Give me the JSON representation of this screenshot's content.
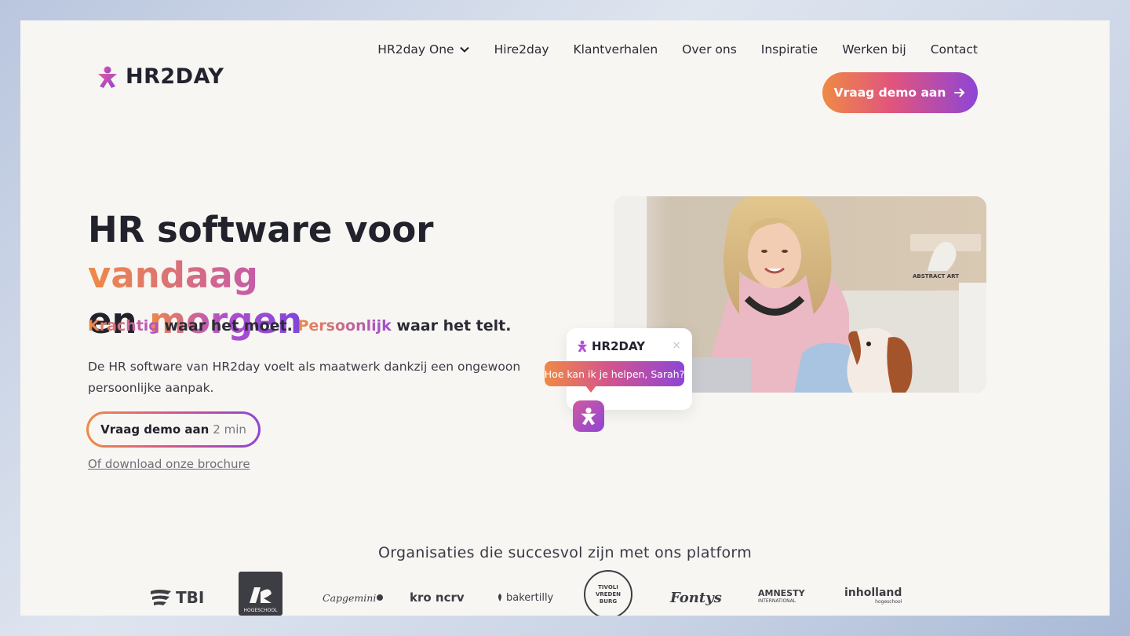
{
  "brand": {
    "name": "HR2DAY"
  },
  "nav": {
    "items": [
      "HR2day One",
      "Hire2day",
      "Klantverhalen",
      "Over ons",
      "Inspiratie",
      "Werken bij",
      "Contact"
    ],
    "demo_button": "Vraag demo aan"
  },
  "hero": {
    "title_part1": "HR software voor ",
    "title_highlight1": "vandaag",
    "title_part2": "en ",
    "title_highlight2": "morgen",
    "tagline_word1": "Krachtig",
    "tagline_part1": " waar het moet. ",
    "tagline_word2": "Persoonlijk",
    "tagline_part2": " waar het telt.",
    "description": "De HR software van HR2day voelt als maatwerk dankzij een ongewoon persoonlijke aanpak.",
    "cta_label": "Vraag demo aan",
    "cta_time": "2 min",
    "brochure_link": "Of download onze brochure"
  },
  "photo": {
    "sign_text": "ABSTRACT ART"
  },
  "chat": {
    "brand": "HR2DAY",
    "close_icon": "×",
    "message": "Hoe kan ik je helpen, Sarah?"
  },
  "organizations": {
    "title": "Organisaties die succesvol zijn met ons platform",
    "logos": [
      "TBI",
      "HOGESCHOOL",
      "Capgemini",
      "kro ncrv",
      "bakertilly",
      "TIVOLI VREDEN BURG",
      "Fontys",
      "AMNESTY",
      "INTERNATIONAL",
      "inholland",
      "hogeschool"
    ]
  },
  "colors": {
    "orange": "#ef8a45",
    "pink": "#d4558c",
    "purple": "#8e45d6",
    "ink": "#22222c",
    "page_bg": "#f8f6f3"
  }
}
